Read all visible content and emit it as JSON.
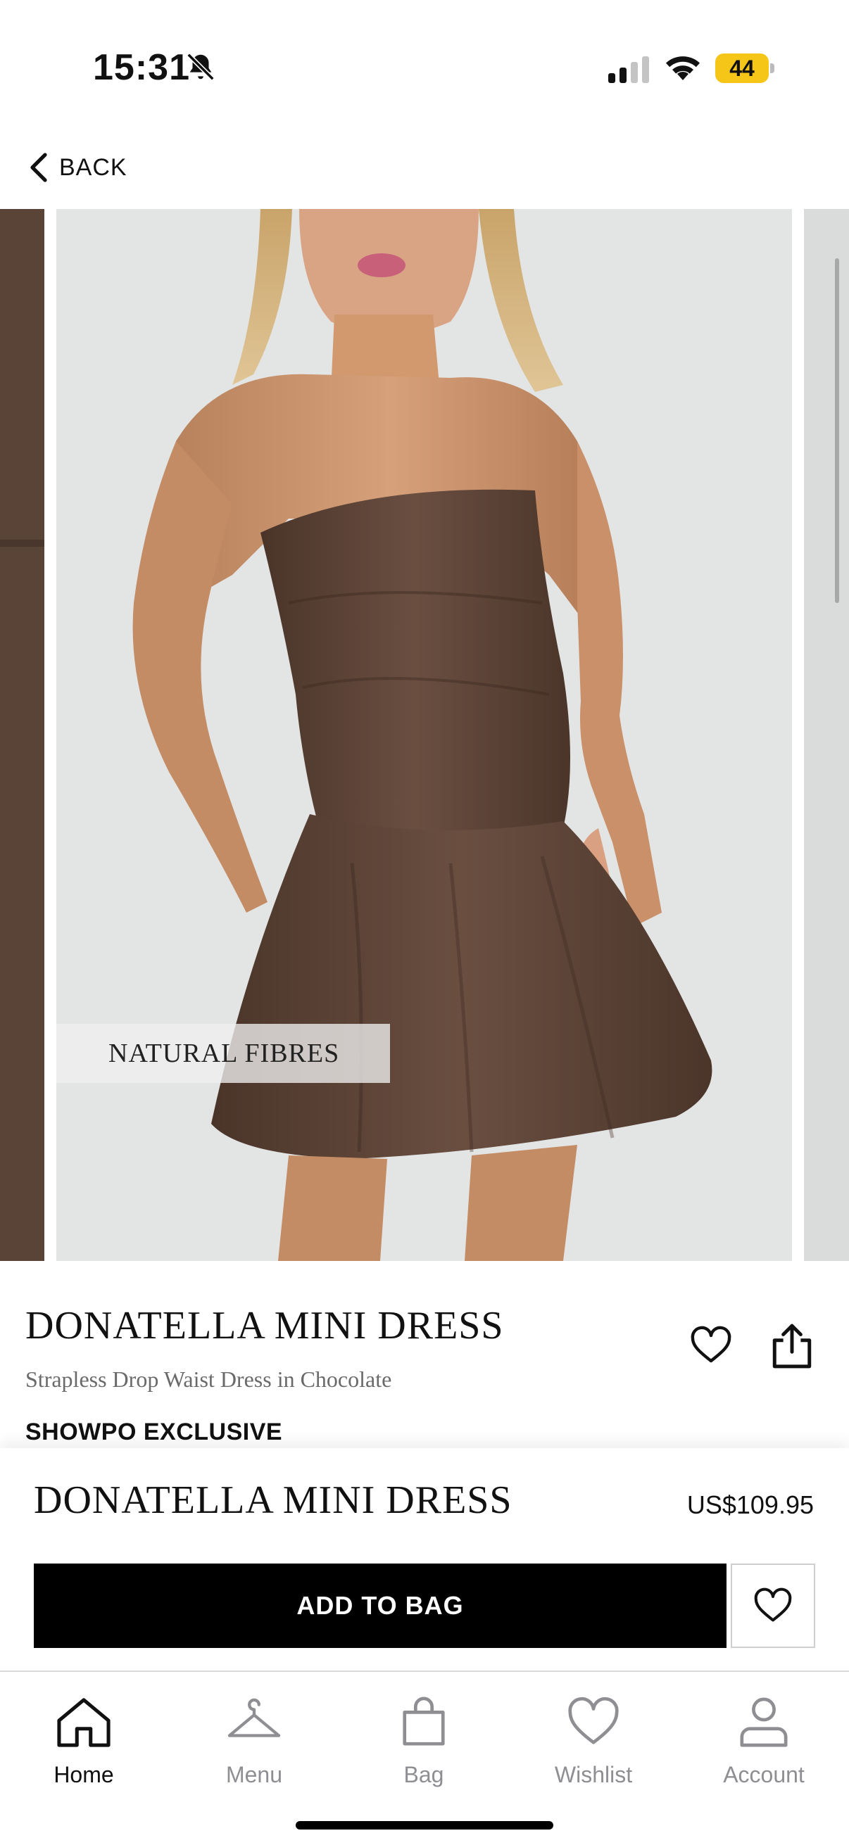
{
  "status_bar": {
    "time": "15:31",
    "battery": "44",
    "icons": [
      "bell-muted-icon",
      "signal-icon",
      "wifi-icon",
      "battery-icon"
    ]
  },
  "nav": {
    "back_label": "BACK"
  },
  "gallery": {
    "badge": "NATURAL FIBRES"
  },
  "product": {
    "name": "DONATELLA MINI DRESS",
    "subtitle": "Strapless Drop Waist Dress in Chocolate",
    "exclusive": "SHOWPO EXCLUSIVE",
    "price": "US$109.95"
  },
  "actions": {
    "add_to_bag": "ADD TO BAG"
  },
  "tabs": [
    {
      "label": "Home",
      "icon": "home-icon"
    },
    {
      "label": "Menu",
      "icon": "hanger-icon"
    },
    {
      "label": "Bag",
      "icon": "bag-icon"
    },
    {
      "label": "Wishlist",
      "icon": "heart-icon"
    },
    {
      "label": "Account",
      "icon": "person-icon"
    }
  ],
  "colors": {
    "dress": "#5e4538",
    "battery": "#f5c518",
    "button": "#000000",
    "inactive_tab": "#8e8e93"
  }
}
